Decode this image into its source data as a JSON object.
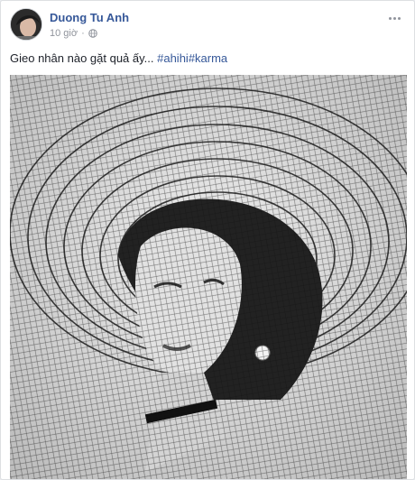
{
  "post": {
    "author": "Duong Tu Anh",
    "timestamp": "10 giờ",
    "separator": "·",
    "privacy_icon": "globe-icon",
    "more_icon": "more-options-icon",
    "message_text": "Gieo nhân nào gặt quả ấy... ",
    "hashtags": [
      "#ahihi",
      "#karma"
    ],
    "photo_alt": "photo",
    "colors": {
      "author_link": "#365899",
      "meta": "#90949c",
      "text": "#1d2129",
      "border": "#dddfe2"
    }
  }
}
